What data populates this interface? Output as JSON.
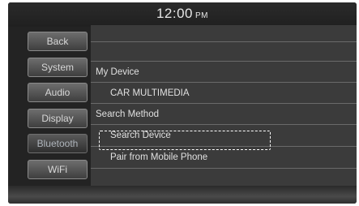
{
  "status_bar": {
    "time": "12:00",
    "ampm": "PM"
  },
  "sidebar": {
    "items": [
      {
        "label": "Back"
      },
      {
        "label": "System"
      },
      {
        "label": "Audio"
      },
      {
        "label": "Display"
      },
      {
        "label": "Bluetooth",
        "active": true
      },
      {
        "label": "WiFi"
      }
    ]
  },
  "main": {
    "rows": [
      {
        "label": ""
      },
      {
        "label": ""
      },
      {
        "label": "My Device"
      },
      {
        "label": "CAR MULTIMEDIA"
      },
      {
        "label": "Search Method"
      },
      {
        "label": "Search Device",
        "focused": true
      },
      {
        "label": "Pair from Mobile Phone"
      }
    ]
  }
}
